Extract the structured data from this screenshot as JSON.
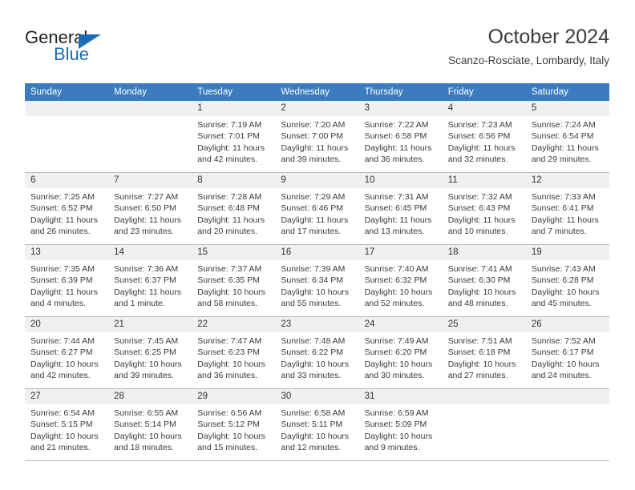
{
  "brand": {
    "name_top": "General",
    "name_bottom": "Blue",
    "accent_color": "#1b6cb5",
    "triangle_icon": "triangle-icon"
  },
  "header": {
    "title": "October 2024",
    "subtitle": "Scanzo-Rosciate, Lombardy, Italy"
  },
  "calendar": {
    "header_bg": "#3a7cbe",
    "header_text_color": "#ffffff",
    "daynum_band_bg": "#f0f0f0",
    "weekday_headers": [
      "Sunday",
      "Monday",
      "Tuesday",
      "Wednesday",
      "Thursday",
      "Friday",
      "Saturday"
    ],
    "weeks": [
      [
        {
          "day": "",
          "lines": []
        },
        {
          "day": "",
          "lines": []
        },
        {
          "day": "1",
          "lines": [
            "Sunrise: 7:19 AM",
            "Sunset: 7:01 PM",
            "Daylight: 11 hours",
            "and 42 minutes."
          ]
        },
        {
          "day": "2",
          "lines": [
            "Sunrise: 7:20 AM",
            "Sunset: 7:00 PM",
            "Daylight: 11 hours",
            "and 39 minutes."
          ]
        },
        {
          "day": "3",
          "lines": [
            "Sunrise: 7:22 AM",
            "Sunset: 6:58 PM",
            "Daylight: 11 hours",
            "and 36 minutes."
          ]
        },
        {
          "day": "4",
          "lines": [
            "Sunrise: 7:23 AM",
            "Sunset: 6:56 PM",
            "Daylight: 11 hours",
            "and 32 minutes."
          ]
        },
        {
          "day": "5",
          "lines": [
            "Sunrise: 7:24 AM",
            "Sunset: 6:54 PM",
            "Daylight: 11 hours",
            "and 29 minutes."
          ]
        }
      ],
      [
        {
          "day": "6",
          "lines": [
            "Sunrise: 7:25 AM",
            "Sunset: 6:52 PM",
            "Daylight: 11 hours",
            "and 26 minutes."
          ]
        },
        {
          "day": "7",
          "lines": [
            "Sunrise: 7:27 AM",
            "Sunset: 6:50 PM",
            "Daylight: 11 hours",
            "and 23 minutes."
          ]
        },
        {
          "day": "8",
          "lines": [
            "Sunrise: 7:28 AM",
            "Sunset: 6:48 PM",
            "Daylight: 11 hours",
            "and 20 minutes."
          ]
        },
        {
          "day": "9",
          "lines": [
            "Sunrise: 7:29 AM",
            "Sunset: 6:46 PM",
            "Daylight: 11 hours",
            "and 17 minutes."
          ]
        },
        {
          "day": "10",
          "lines": [
            "Sunrise: 7:31 AM",
            "Sunset: 6:45 PM",
            "Daylight: 11 hours",
            "and 13 minutes."
          ]
        },
        {
          "day": "11",
          "lines": [
            "Sunrise: 7:32 AM",
            "Sunset: 6:43 PM",
            "Daylight: 11 hours",
            "and 10 minutes."
          ]
        },
        {
          "day": "12",
          "lines": [
            "Sunrise: 7:33 AM",
            "Sunset: 6:41 PM",
            "Daylight: 11 hours",
            "and 7 minutes."
          ]
        }
      ],
      [
        {
          "day": "13",
          "lines": [
            "Sunrise: 7:35 AM",
            "Sunset: 6:39 PM",
            "Daylight: 11 hours",
            "and 4 minutes."
          ]
        },
        {
          "day": "14",
          "lines": [
            "Sunrise: 7:36 AM",
            "Sunset: 6:37 PM",
            "Daylight: 11 hours",
            "and 1 minute."
          ]
        },
        {
          "day": "15",
          "lines": [
            "Sunrise: 7:37 AM",
            "Sunset: 6:35 PM",
            "Daylight: 10 hours",
            "and 58 minutes."
          ]
        },
        {
          "day": "16",
          "lines": [
            "Sunrise: 7:39 AM",
            "Sunset: 6:34 PM",
            "Daylight: 10 hours",
            "and 55 minutes."
          ]
        },
        {
          "day": "17",
          "lines": [
            "Sunrise: 7:40 AM",
            "Sunset: 6:32 PM",
            "Daylight: 10 hours",
            "and 52 minutes."
          ]
        },
        {
          "day": "18",
          "lines": [
            "Sunrise: 7:41 AM",
            "Sunset: 6:30 PM",
            "Daylight: 10 hours",
            "and 48 minutes."
          ]
        },
        {
          "day": "19",
          "lines": [
            "Sunrise: 7:43 AM",
            "Sunset: 6:28 PM",
            "Daylight: 10 hours",
            "and 45 minutes."
          ]
        }
      ],
      [
        {
          "day": "20",
          "lines": [
            "Sunrise: 7:44 AM",
            "Sunset: 6:27 PM",
            "Daylight: 10 hours",
            "and 42 minutes."
          ]
        },
        {
          "day": "21",
          "lines": [
            "Sunrise: 7:45 AM",
            "Sunset: 6:25 PM",
            "Daylight: 10 hours",
            "and 39 minutes."
          ]
        },
        {
          "day": "22",
          "lines": [
            "Sunrise: 7:47 AM",
            "Sunset: 6:23 PM",
            "Daylight: 10 hours",
            "and 36 minutes."
          ]
        },
        {
          "day": "23",
          "lines": [
            "Sunrise: 7:48 AM",
            "Sunset: 6:22 PM",
            "Daylight: 10 hours",
            "and 33 minutes."
          ]
        },
        {
          "day": "24",
          "lines": [
            "Sunrise: 7:49 AM",
            "Sunset: 6:20 PM",
            "Daylight: 10 hours",
            "and 30 minutes."
          ]
        },
        {
          "day": "25",
          "lines": [
            "Sunrise: 7:51 AM",
            "Sunset: 6:18 PM",
            "Daylight: 10 hours",
            "and 27 minutes."
          ]
        },
        {
          "day": "26",
          "lines": [
            "Sunrise: 7:52 AM",
            "Sunset: 6:17 PM",
            "Daylight: 10 hours",
            "and 24 minutes."
          ]
        }
      ],
      [
        {
          "day": "27",
          "lines": [
            "Sunrise: 6:54 AM",
            "Sunset: 5:15 PM",
            "Daylight: 10 hours",
            "and 21 minutes."
          ]
        },
        {
          "day": "28",
          "lines": [
            "Sunrise: 6:55 AM",
            "Sunset: 5:14 PM",
            "Daylight: 10 hours",
            "and 18 minutes."
          ]
        },
        {
          "day": "29",
          "lines": [
            "Sunrise: 6:56 AM",
            "Sunset: 5:12 PM",
            "Daylight: 10 hours",
            "and 15 minutes."
          ]
        },
        {
          "day": "30",
          "lines": [
            "Sunrise: 6:58 AM",
            "Sunset: 5:11 PM",
            "Daylight: 10 hours",
            "and 12 minutes."
          ]
        },
        {
          "day": "31",
          "lines": [
            "Sunrise: 6:59 AM",
            "Sunset: 5:09 PM",
            "Daylight: 10 hours",
            "and 9 minutes."
          ]
        },
        {
          "day": "",
          "lines": []
        },
        {
          "day": "",
          "lines": []
        }
      ]
    ]
  }
}
